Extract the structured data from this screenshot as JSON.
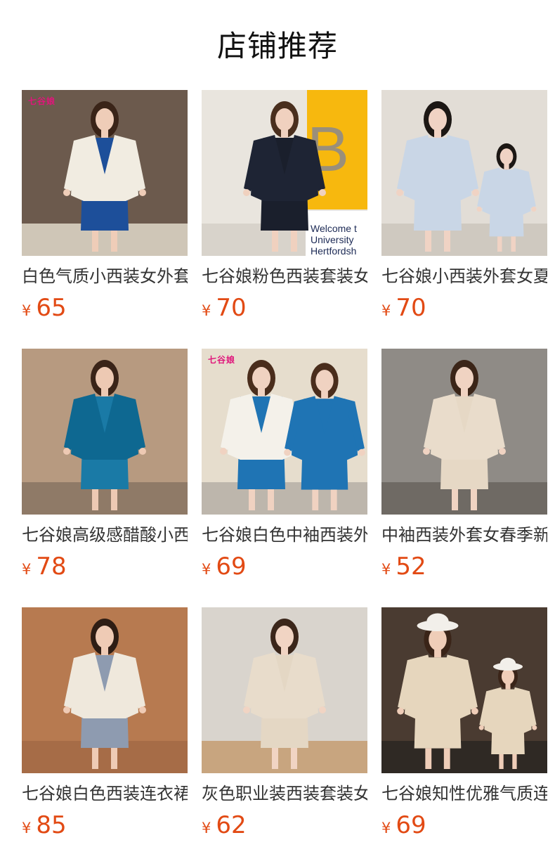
{
  "header": {
    "title": "店铺推荐"
  },
  "products": [
    {
      "name": "白色气质小西装女外套",
      "currency": "¥",
      "price": "65",
      "watermark": "七谷娘",
      "bg": "#6c5a4d",
      "floor": "#cfc6b7",
      "hair": "#3a2418",
      "jacket": "#f1ece1",
      "dress": "#1d4f9a",
      "skin": "#efcdb8"
    },
    {
      "name": "七谷娘粉色西装套装女",
      "currency": "¥",
      "price": "70",
      "bg": "#e9e5de",
      "floor": "#d8d3cb",
      "hair": "#4a2f1e",
      "jacket": "#1e2434",
      "dress": "#1a1f2c",
      "skin": "#f0d1bf",
      "accent": "#f7b80e",
      "sign": [
        "Welcome t",
        "University",
        "Hertfordsh"
      ]
    },
    {
      "name": "七谷娘小西装外套女夏季",
      "currency": "¥",
      "price": "70",
      "bg": "#e2ddd6",
      "floor": "#cfc9c0",
      "hair": "#1c1714",
      "jacket": "#c9d6e6",
      "dress": "#c9d6e6",
      "skin": "#f0d3c4"
    },
    {
      "name": "七谷娘高级感醋酸小西装",
      "currency": "¥",
      "price": "78",
      "bg": "#b79a80",
      "floor": "#8f7a67",
      "hair": "#3a2418",
      "jacket": "#0e6891",
      "dress": "#1a7aa6",
      "skin": "#edc9b3"
    },
    {
      "name": "七谷娘白色中袖西装外套",
      "currency": "¥",
      "price": "69",
      "watermark": "七谷娘",
      "bg": "#e6ddcd",
      "floor": "#bdb6ac",
      "hair": "#4a2d1c",
      "jacket": "#f4f1ea",
      "dress": "#1f74b4",
      "skin": "#f0d2c1"
    },
    {
      "name": "中袖西装外套女春季新款",
      "currency": "¥",
      "price": "52",
      "bg": "#8f8b86",
      "floor": "#6f6a64",
      "hair": "#3b2518",
      "jacket": "#e9dccb",
      "dress": "#e6d8c5",
      "skin": "#f0d3c2"
    },
    {
      "name": "七谷娘白色西装连衣裙",
      "currency": "¥",
      "price": "85",
      "bg": "#b77a50",
      "floor": "#a66c47",
      "hair": "#2e1d14",
      "jacket": "#efe8dc",
      "dress": "#8e9bb0",
      "skin": "#efcbb5"
    },
    {
      "name": "灰色职业装西装套装女",
      "currency": "¥",
      "price": "62",
      "bg": "#d9d4cd",
      "floor": "#c8a57f",
      "hair": "#3b261a",
      "jacket": "#e8dccb",
      "dress": "#e4d7c4",
      "skin": "#f1d4c3"
    },
    {
      "name": "七谷娘知性优雅气质连衣裙",
      "currency": "¥",
      "price": "69",
      "bg": "#4a3b31",
      "floor": "#2f2924",
      "hair": "#3a2418",
      "jacket": "#e6d6bd",
      "dress": "#e6d6bd",
      "skin": "#efcdb8",
      "hat": "#f2efea"
    }
  ]
}
